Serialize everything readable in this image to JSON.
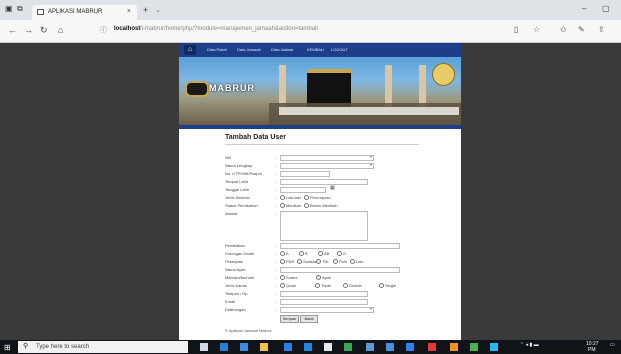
{
  "browser": {
    "tab_title": "APLIKASI MABRUR",
    "tab_close": "×",
    "new_tab": "+",
    "tab_dropdown": "⌄",
    "address_host": "localhost",
    "address_path": "/i-mabrur/home/php/?module=manajemen_jamaah&action=tambah",
    "window_min": "–",
    "window_max": "▢"
  },
  "site": {
    "logo_text": "MABRUR",
    "menu_items": [
      "Data Paket",
      "Data Jamaah",
      "Data Jadwal",
      "KEMBALI",
      "LOGOUT"
    ],
    "home_glyph": "⌂"
  },
  "form": {
    "title": "Tambah Data User",
    "labels": [
      "NIK",
      "Nama Lengkap",
      "No. KTP/SIM/Paspor",
      "Tempat Lahir",
      "Tanggal Lahir",
      "Jenis Kelamin",
      "Status Pernikahan",
      "Alamat",
      "Pendidikan",
      "Golongan Darah",
      "Pekerjaan",
      "Nama Ayah",
      "Mahram/Muhrim",
      "Jenis Kamar",
      "Telepon / Hp",
      "Email",
      "Keterangan"
    ],
    "gender_options": [
      "Laki-laki",
      "Perempuan"
    ],
    "marital_options": [
      "Menikah",
      "Belum Menikah"
    ],
    "blood_options": [
      "A",
      "B",
      "AB",
      "O"
    ],
    "job_options": [
      "PNS",
      "Swasta",
      "TNI",
      "Polri",
      "Lain"
    ],
    "mahram_options": [
      "Suami",
      "Ayah"
    ],
    "room_options": [
      "Quad",
      "Triple",
      "Double",
      "Single"
    ],
    "save_label": "Simpan",
    "reset_label": "Batal",
    "footer_note": "© Aplikasi Jamaah Mabrur"
  },
  "taskbar": {
    "search_placeholder": "Type here to search",
    "time": "10:27",
    "date": "PM"
  }
}
